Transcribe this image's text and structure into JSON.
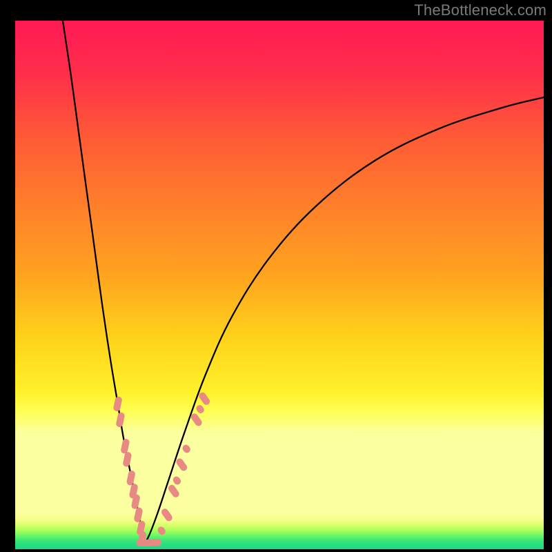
{
  "watermark": "TheBottleneck.com",
  "frame": {
    "outer_left": 20,
    "outer_top": 28,
    "outer_width": 770,
    "outer_height": 770,
    "border_width": 2,
    "border_color": "#000000"
  },
  "gradient_stops": [
    {
      "pct": 0,
      "color": "#ff1a55"
    },
    {
      "pct": 10,
      "color": "#ff2e4a"
    },
    {
      "pct": 22,
      "color": "#ff5a36"
    },
    {
      "pct": 35,
      "color": "#ff7f2a"
    },
    {
      "pct": 48,
      "color": "#ffa31f"
    },
    {
      "pct": 60,
      "color": "#ffd21a"
    },
    {
      "pct": 70,
      "color": "#fff02a"
    },
    {
      "pct": 74,
      "color": "#ffff55"
    },
    {
      "pct": 78,
      "color": "#fcffa0"
    },
    {
      "pct": 93,
      "color": "#fcffa0"
    },
    {
      "pct": 94.5,
      "color": "#f3ff8a"
    },
    {
      "pct": 95.5,
      "color": "#d6ff6a"
    },
    {
      "pct": 96.5,
      "color": "#a6ff5a"
    },
    {
      "pct": 97.5,
      "color": "#66f56a"
    },
    {
      "pct": 98.5,
      "color": "#33e57a"
    },
    {
      "pct": 100,
      "color": "#1fd687"
    }
  ],
  "chart_data": {
    "type": "line",
    "title": "",
    "xlabel": "",
    "ylabel": "",
    "xlim": [
      0,
      100
    ],
    "ylim": [
      0,
      100
    ],
    "series": [
      {
        "name": "left-branch",
        "x": [
          9.0,
          10.5,
          12.0,
          13.5,
          15.0,
          16.5,
          18.0,
          19.5,
          20.5,
          21.5,
          22.3,
          23.0,
          23.6,
          24.1,
          24.5
        ],
        "y": [
          100.0,
          90.0,
          79.0,
          68.0,
          57.0,
          46.0,
          36.0,
          27.0,
          21.0,
          16.0,
          12.0,
          8.5,
          5.5,
          3.0,
          1.0
        ]
      },
      {
        "name": "right-branch",
        "x": [
          24.5,
          25.5,
          27.0,
          29.0,
          32.0,
          36.0,
          41.0,
          48.0,
          57.0,
          68.0,
          80.0,
          92.0,
          100.0
        ],
        "y": [
          1.0,
          3.0,
          7.0,
          13.0,
          22.0,
          33.0,
          44.0,
          55.0,
          65.0,
          73.5,
          79.5,
          83.5,
          85.5
        ]
      }
    ],
    "valley_x": 24.5,
    "markers": {
      "name": "sample-dots",
      "shape": "capsule",
      "color": "#e88a84",
      "points_left": [
        {
          "x": 19.4,
          "y": 27.5,
          "dir": "steep"
        },
        {
          "x": 19.9,
          "y": 24.5,
          "dir": "steep"
        },
        {
          "x": 20.8,
          "y": 19.5,
          "dir": "steep"
        },
        {
          "x": 21.2,
          "y": 17.0,
          "dir": "steep"
        },
        {
          "x": 21.9,
          "y": 13.5,
          "dir": "steep"
        },
        {
          "x": 22.4,
          "y": 11.0,
          "dir": "steep"
        },
        {
          "x": 22.8,
          "y": 9.0,
          "dir": "steep"
        },
        {
          "x": 23.3,
          "y": 6.5,
          "dir": "steep"
        },
        {
          "x": 23.8,
          "y": 4.0,
          "dir": "steep"
        },
        {
          "x": 24.1,
          "y": 2.5,
          "dir": "steep-short"
        }
      ],
      "points_bottom": [
        {
          "x": 24.0,
          "y": 1.2,
          "dir": "flat"
        },
        {
          "x": 25.3,
          "y": 1.2,
          "dir": "flat"
        },
        {
          "x": 26.6,
          "y": 1.3,
          "dir": "flat"
        }
      ],
      "points_right": [
        {
          "x": 27.7,
          "y": 3.5,
          "dir": "rise-short"
        },
        {
          "x": 28.7,
          "y": 6.5,
          "dir": "rise"
        },
        {
          "x": 30.0,
          "y": 11.0,
          "dir": "rise"
        },
        {
          "x": 30.6,
          "y": 13.0,
          "dir": "rise-short"
        },
        {
          "x": 31.5,
          "y": 16.0,
          "dir": "rise"
        },
        {
          "x": 32.4,
          "y": 19.0,
          "dir": "rise-short"
        },
        {
          "x": 34.3,
          "y": 24.5,
          "dir": "rise"
        },
        {
          "x": 35.0,
          "y": 26.5,
          "dir": "rise-short"
        },
        {
          "x": 35.8,
          "y": 28.5,
          "dir": "rise"
        }
      ]
    }
  }
}
